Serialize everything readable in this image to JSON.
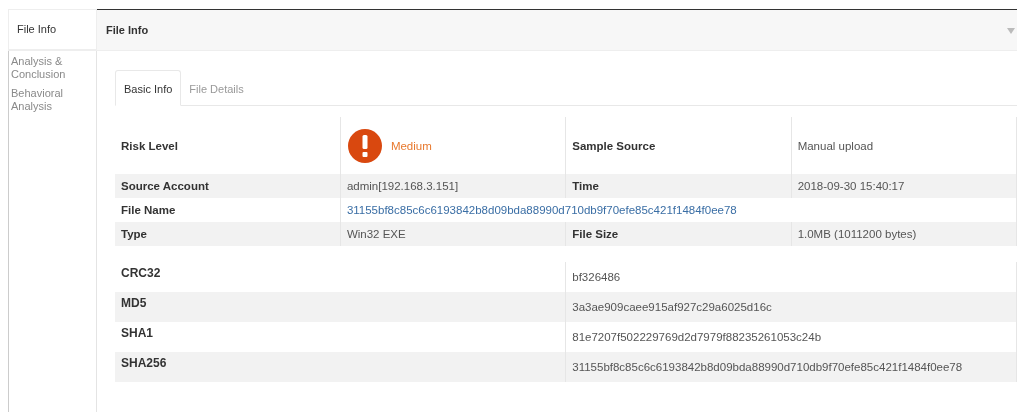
{
  "sidebar": {
    "items": [
      {
        "label": "File Info",
        "selected": true
      },
      {
        "label": "Analysis & Conclusion",
        "selected": false
      },
      {
        "label": "Behavioral Analysis",
        "selected": false
      }
    ]
  },
  "header": {
    "title": "File Info"
  },
  "tabs": [
    {
      "label": "Basic Info",
      "selected": true
    },
    {
      "label": "File Details",
      "selected": false
    }
  ],
  "basic_table": {
    "rows": [
      {
        "cells": [
          {
            "kind": "label",
            "text": "Risk Level"
          },
          {
            "kind": "risk",
            "text": "Medium"
          },
          {
            "kind": "label",
            "text": "Sample Source"
          },
          {
            "kind": "value",
            "text": "Manual upload"
          }
        ]
      },
      {
        "cells": [
          {
            "kind": "label",
            "text": "Source Account"
          },
          {
            "kind": "value",
            "text": "admin[192.168.3.151]"
          },
          {
            "kind": "label",
            "text": "Time"
          },
          {
            "kind": "value",
            "text": "2018-09-30 15:40:17"
          }
        ]
      },
      {
        "cells": [
          {
            "kind": "label",
            "text": "File Name"
          },
          {
            "kind": "link",
            "colspan": 3,
            "text": "31155bf8c85c6c6193842b8d09bda88990d710db9f70efe85c421f1484f0ee78"
          }
        ]
      },
      {
        "cells": [
          {
            "kind": "label",
            "text": "Type"
          },
          {
            "kind": "value",
            "text": "Win32 EXE"
          },
          {
            "kind": "label",
            "text": "File Size"
          },
          {
            "kind": "value",
            "text": "1.0MB (1011200 bytes)"
          }
        ]
      }
    ]
  },
  "hash_table": {
    "rows": [
      {
        "name": "CRC32",
        "value": "bf326486"
      },
      {
        "name": "MD5",
        "value": "3a3ae909caee915af927c29a6025d16c"
      },
      {
        "name": "SHA1",
        "value": "81e7207f502229769d2d7979f88235261053c24b"
      },
      {
        "name": "SHA256",
        "value": "31155bf8c85c6c6193842b8d09bda88990d710db9f70efe85c421f1484f0ee78"
      }
    ]
  }
}
